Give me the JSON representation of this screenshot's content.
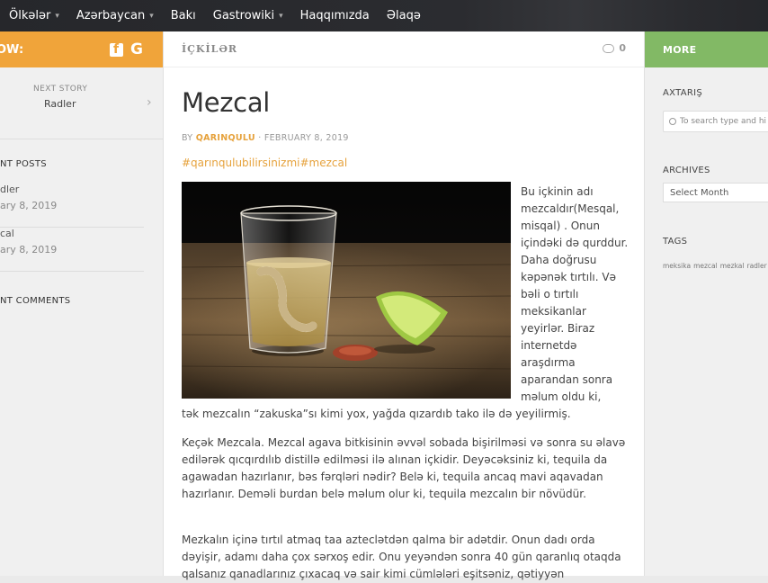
{
  "nav": {
    "items": [
      {
        "label": "Ölkələr",
        "has_caret": true
      },
      {
        "label": "Azərbaycan",
        "has_caret": true
      },
      {
        "label": "Bakı",
        "has_caret": false
      },
      {
        "label": "Gastrowiki",
        "has_caret": true
      },
      {
        "label": "Haqqımızda",
        "has_caret": false
      },
      {
        "label": "Əlaqə",
        "has_caret": false
      }
    ]
  },
  "left_sidebar": {
    "follow_label": "OW:",
    "icons": [
      "facebook-icon",
      "google-icon"
    ],
    "next_story_label": "NEXT STORY",
    "next_story_title": "Radler",
    "recent_posts_heading": "NT POSTS",
    "recent_posts": [
      {
        "title": "dler",
        "date": "ary 8, 2019"
      },
      {
        "title": "cal",
        "date": "ary 8, 2019"
      }
    ],
    "recent_comments_heading": "NT COMMENTS"
  },
  "main": {
    "category": "İÇKİLƏR",
    "comment_count": "0",
    "title": "Mezcal",
    "byline_prefix": "BY",
    "author": "QARINQULU",
    "byline_sep": " · ",
    "date": "FEBRUARY 8, 2019",
    "hashtags": "#qarınqulubilirsinizmi#mezcal",
    "side_text": "Bu içkinin adı mezcaldır(Mesqal, misqal) . Onun içindəki də qurddur. Daha doğrusu kəpənək tırtılı. Və bəli o tırtılı meksikanlar yeyirlər. Biraz internetdə araşdırma aparandan sonra məlum oldu ki,",
    "continuation": "tək mezcalın “zakuska”sı kimi yox, yağda qızardıb tako ilə də yeyilirmiş.",
    "paragraph2": "Keçək Mezcala. Mezcal agava bitkisinin əvvəl sobada bişirilməsi və sonra su əlavə edilərək qıcqırdılıb distillə edilməsi ilə alınan içkidir. Deyəcəksiniz ki, tequila da agawadan hazırlanır, bəs fərqləri nədir? Belə ki, tequila ancaq mavi aqavadan hazırlanır. Deməli burdan belə məlum olur ki, tequila mezcalın bir növüdür.",
    "paragraph3": "Mezkalın içinə tırtıl atmaq taa azteclətdən qalma bir adətdir. Onun dadı orda dəyişir, adamı daha çox sərxoş edir. Onu yeyəndən sonra 40 gün qaranlıq otaqda qalsanız qanadlarınız çıxacaq və sair kimi cümlələri eşitsəniz, qətiyyən"
  },
  "right_sidebar": {
    "more_label": "MORE",
    "search_heading": "AXTARIŞ",
    "search_placeholder": "To search type and hi",
    "archives_heading": "ARCHIVES",
    "archives_selected": "Select Month",
    "tags_heading": "TAGS",
    "tags": [
      "meksika",
      "mezcal",
      "mezkal",
      "radler"
    ]
  },
  "colors": {
    "accent_orange": "#f0a43a",
    "accent_green": "#82b965",
    "link": "#e6a23c",
    "nav_bg": "#26272b"
  }
}
